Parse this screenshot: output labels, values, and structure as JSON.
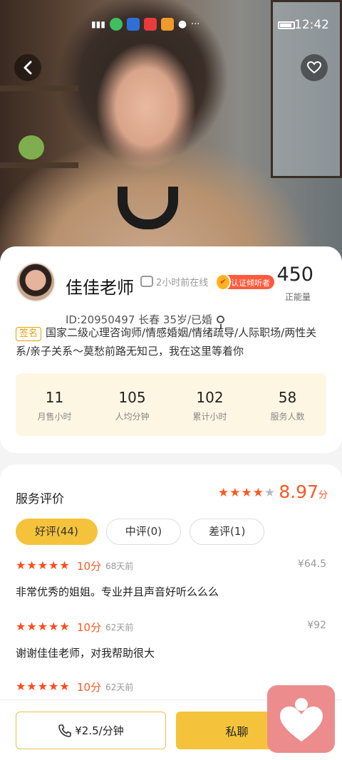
{
  "status_bar": {
    "time": "12:42",
    "more": "···"
  },
  "hero": {
    "back_icon": "chevron-left-icon",
    "favorite_icon": "heart-outline-icon"
  },
  "profile": {
    "name": "佳佳老师",
    "online_status": "2小时前在线",
    "certification": "认证倾听者",
    "energy_value": "450",
    "energy_label": "正能量",
    "meta": "ID:20950497  长春 35岁/已婚",
    "signature_tag": "签名",
    "signature": "国家二级心理咨询师/情感婚姻/情绪疏导/人际职场/两性关系/亲子关系～莫愁前路无知己，我在这里等着你"
  },
  "stats": [
    {
      "value": "11",
      "label": "月售小时"
    },
    {
      "value": "105",
      "label": "人均分钟"
    },
    {
      "value": "102",
      "label": "累计小时"
    },
    {
      "value": "58",
      "label": "服务人数"
    }
  ],
  "reviews": {
    "title": "服务评价",
    "rating_stars": 4,
    "rating_score": "8.97",
    "rating_unit": "分",
    "tabs": [
      {
        "label": "好评(44)",
        "active": true
      },
      {
        "label": "中评(0)",
        "active": false
      },
      {
        "label": "差评(1)",
        "active": false
      }
    ],
    "items": [
      {
        "stars": 5,
        "score": "10分",
        "ago": "68天前",
        "price": "¥64.5",
        "text": "非常优秀的姐姐。专业并且声音好听么么么"
      },
      {
        "stars": 5,
        "score": "10分",
        "ago": "62天前",
        "price": "¥92",
        "text": "谢谢佳佳老师，对我帮助很大"
      },
      {
        "stars": 5,
        "score": "10分",
        "ago": "62天前",
        "price": "",
        "text": ""
      }
    ]
  },
  "bottom": {
    "call_label": "¥2.5/分钟",
    "call_icon": "phone-icon",
    "chat_label": "私聊",
    "float_icon": "heart-person-icon"
  },
  "colors": {
    "accent_yellow": "#f5c33b",
    "accent_orange": "#ff5722",
    "badge_pink": "#ec8c8c"
  }
}
